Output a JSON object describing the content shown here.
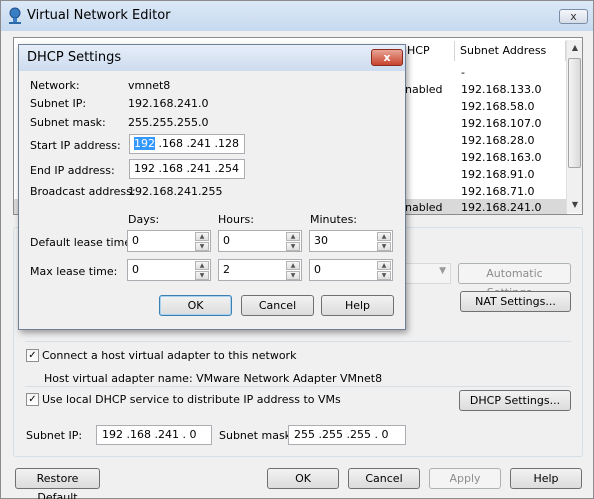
{
  "window": {
    "title": "Virtual Network Editor",
    "close_glyph": "x"
  },
  "table": {
    "headers": [
      "HCP",
      "Subnet Address"
    ],
    "rows": [
      {
        "dhcp": "",
        "subnet": "-"
      },
      {
        "dhcp": "nabled",
        "subnet": "192.168.133.0"
      },
      {
        "dhcp": "",
        "subnet": "192.168.58.0"
      },
      {
        "dhcp": "",
        "subnet": "192.168.107.0"
      },
      {
        "dhcp": "",
        "subnet": "192.168.28.0"
      },
      {
        "dhcp": "",
        "subnet": "192.168.163.0"
      },
      {
        "dhcp": "",
        "subnet": "192.168.91.0"
      },
      {
        "dhcp": "",
        "subnet": "192.168.71.0"
      },
      {
        "dhcp": "nabled",
        "subnet": "192.168.241.0"
      }
    ]
  },
  "main": {
    "automatic_settings": "Automatic Settings...",
    "nat_settings": "NAT Settings...",
    "connect_host_adapter": "Connect a host virtual adapter to this network",
    "host_adapter_name": "Host virtual adapter name: VMware Network Adapter VMnet8",
    "use_local_dhcp": "Use local DHCP service to distribute IP address to VMs",
    "dhcp_settings": "DHCP Settings...",
    "subnet_ip_label": "Subnet IP:",
    "subnet_ip_value": "192 .168 .241 .  0",
    "subnet_mask_label": "Subnet mask:",
    "subnet_mask_value": "255 .255 .255 .  0",
    "check_glyph": "✓"
  },
  "footer": {
    "restore_default": "Restore Default",
    "ok": "OK",
    "cancel": "Cancel",
    "apply": "Apply",
    "help": "Help"
  },
  "dialog": {
    "title": "DHCP Settings",
    "close_glyph": "x",
    "network_label": "Network:",
    "network_value": "vmnet8",
    "subnet_ip_label": "Subnet IP:",
    "subnet_ip_value": "192.168.241.0",
    "subnet_mask_label": "Subnet mask:",
    "subnet_mask_value": "255.255.255.0",
    "start_ip_label": "Start IP address:",
    "start_ip_sel": "192",
    "start_ip_rest": " .168 .241 .128",
    "end_ip_label": "End IP address:",
    "end_ip_value": "192 .168 .241 .254",
    "broadcast_label": "Broadcast address:",
    "broadcast_value": "192.168.241.255",
    "days_label": "Days:",
    "hours_label": "Hours:",
    "minutes_label": "Minutes:",
    "default_lease_label": "Default lease time:",
    "default_days": "0",
    "default_hours": "0",
    "default_minutes": "30",
    "max_lease_label": "Max lease time:",
    "max_days": "0",
    "max_hours": "2",
    "max_minutes": "0",
    "ok": "OK",
    "cancel": "Cancel",
    "help": "Help",
    "spin_up_glyph": "▲",
    "spin_down_glyph": "▼"
  }
}
